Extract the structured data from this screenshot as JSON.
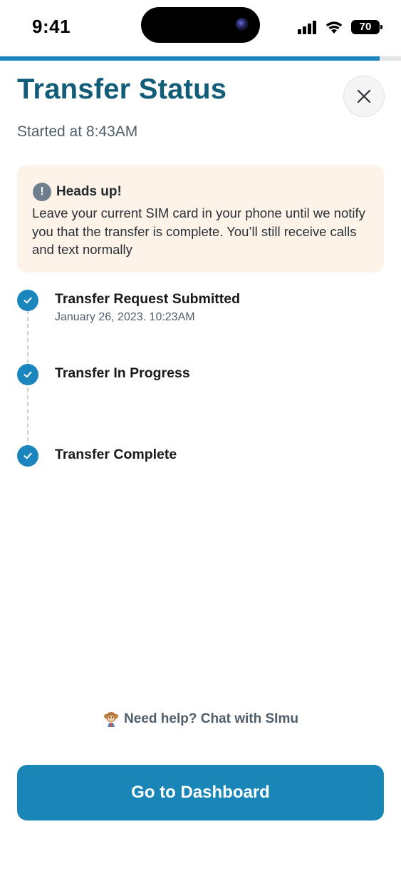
{
  "status_bar": {
    "time": "9:41",
    "battery": "70",
    "icons": [
      "signal-icon",
      "wifi-icon",
      "battery-icon"
    ]
  },
  "progress": {
    "fraction": 0.947,
    "color": "#1a86bd"
  },
  "header": {
    "title": "Transfer Status",
    "subtitle": "Started at 8:43AM",
    "close_icon": "close-icon"
  },
  "alert": {
    "icon": "exclamation-icon",
    "title": "Heads up!",
    "body": "Leave your current SIM card in your phone until we notify you that the transfer is complete. You’ll still receive calls and text normally"
  },
  "timeline": {
    "steps": [
      {
        "title": "Transfer Request Submitted",
        "date": "January 26, 2023. 10:23AM",
        "status": "complete"
      },
      {
        "title": "Transfer In Progress",
        "date": "",
        "status": "complete"
      },
      {
        "title": "Transfer Complete",
        "date": "",
        "status": "complete"
      }
    ]
  },
  "help": {
    "icon": "monkey-mascot-icon",
    "label": "Need help? Chat with SImu"
  },
  "actions": {
    "primary_label": "Go to Dashboard"
  },
  "colors": {
    "title": "#115c78",
    "accent": "#1a86bd",
    "alert_background": "#fdf3e8",
    "button": "#1a86b8"
  }
}
